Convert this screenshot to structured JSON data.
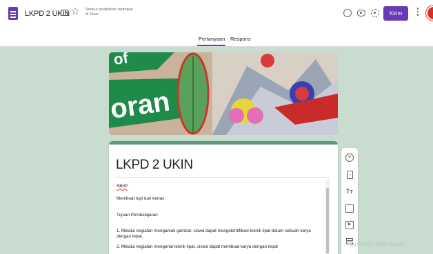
{
  "header": {
    "doc_title": "LKPD 2 UKIN",
    "save_status_line1": "Semua perubahan disimpan",
    "save_status_line2": "di Drive",
    "send_label": "Kirim"
  },
  "icons": {
    "app": "google-forms-icon",
    "folder": "folder-icon",
    "star": "star-icon",
    "palette": "palette-icon",
    "preview": "eye-icon",
    "settings": "gear-icon",
    "more": "more-vert-icon"
  },
  "tabs": [
    {
      "label": "Pertanyaan",
      "active": true
    },
    {
      "label": "Respons",
      "active": false
    }
  ],
  "header_image": {
    "banner_text": "oran",
    "banner_text_partial": "of"
  },
  "form": {
    "title": "LKPD 2 UKIN",
    "description_lines": [
      "SBdP",
      "Membuat topi dari kertas",
      "Tujuan Pembelajaran",
      "1. Melalui kegiatan mengamati gambar, siswa dapat mengidentifikasi teknik lipat dalam sebuah karya dengan tepat.",
      "2. Melalui kegiatan mengenal teknik lipat, siswa dapat membuat karya dengan tepat"
    ]
  },
  "floating_toolbar": [
    {
      "name": "add-question-icon",
      "glyph": "+"
    },
    {
      "name": "import-questions-icon",
      "glyph": "→"
    },
    {
      "name": "add-title-icon",
      "glyph": "Tт"
    },
    {
      "name": "add-image-icon",
      "glyph": ""
    },
    {
      "name": "add-video-icon",
      "glyph": "▶"
    },
    {
      "name": "add-section-icon",
      "glyph": ""
    }
  ],
  "watermark": "Activate Windows",
  "colors": {
    "accent": "#673ab7",
    "background": "#c8ddd0",
    "card_accent": "#5c9b7a",
    "avatar": "#d93025"
  }
}
